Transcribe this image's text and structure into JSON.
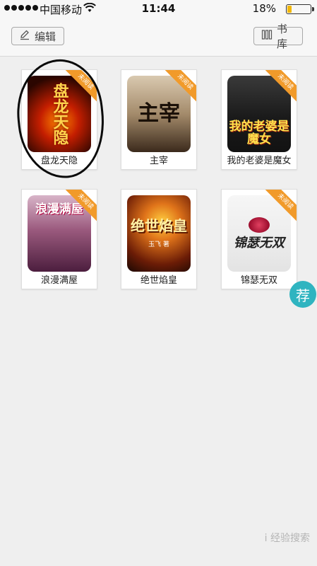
{
  "status_bar": {
    "carrier": "中国移动",
    "time": "11:44",
    "battery": "18%",
    "battery_level": 0.18
  },
  "toolbar": {
    "edit_label": "编辑",
    "library_label": "书库"
  },
  "shelf": {
    "unread_tag": "未阅读",
    "books": [
      {
        "title": "盘龙天隐",
        "cover_text": "盘龙天隐"
      },
      {
        "title": "主宰",
        "cover_text": "主宰"
      },
      {
        "title": "我的老婆是魔女",
        "cover_text": "我的老婆是魔女"
      },
      {
        "title": "浪漫满屋",
        "cover_text": "浪漫满屋"
      },
      {
        "title": "绝世焰皇",
        "cover_text": "绝世焰皇",
        "cover_author": "玉飞 著"
      },
      {
        "title": "锦瑟无双",
        "cover_text": "锦瑟无双"
      }
    ]
  },
  "recommend_label": "荐",
  "watermark": "i 经验搜索",
  "colors": {
    "ribbon": "#f19a2a",
    "recommend": "#2fb4c0",
    "battery_fill": "#f2b705"
  }
}
